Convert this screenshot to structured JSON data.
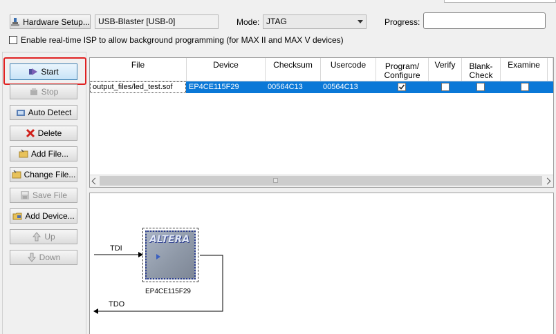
{
  "toolbar": {
    "hardware_setup_label": "Hardware Setup...",
    "hardware_value": "USB-Blaster [USB-0]",
    "mode_label": "Mode:",
    "mode_value": "JTAG",
    "progress_label": "Progress:",
    "isp_checkbox_label": "Enable real-time ISP to allow background programming (for MAX II and MAX V devices)",
    "isp_checked": false
  },
  "side_buttons": {
    "start": "Start",
    "stop": "Stop",
    "auto_detect": "Auto Detect",
    "delete": "Delete",
    "add_file": "Add File...",
    "change_file": "Change File...",
    "save_file": "Save File",
    "add_device": "Add Device...",
    "up": "Up",
    "down": "Down"
  },
  "table": {
    "headers": {
      "file": "File",
      "device": "Device",
      "checksum": "Checksum",
      "usercode": "Usercode",
      "program_line1": "Program/",
      "program_line2": "Configure",
      "verify": "Verify",
      "blank_line1": "Blank-",
      "blank_line2": "Check",
      "examine": "Examine"
    },
    "rows": [
      {
        "file": "output_files/led_test.sof",
        "device": "EP4CE115F29",
        "checksum": "00564C13",
        "usercode": "00564C13",
        "program": true,
        "verify": false,
        "blank_check": false,
        "examine": false
      }
    ]
  },
  "diagram": {
    "tdi_label": "TDI",
    "tdo_label": "TDO",
    "chip_logo": "ALTERA",
    "chip_name": "EP4CE115F29"
  },
  "colors": {
    "selection": "#0a78d7",
    "highlight_border": "#e02020"
  }
}
